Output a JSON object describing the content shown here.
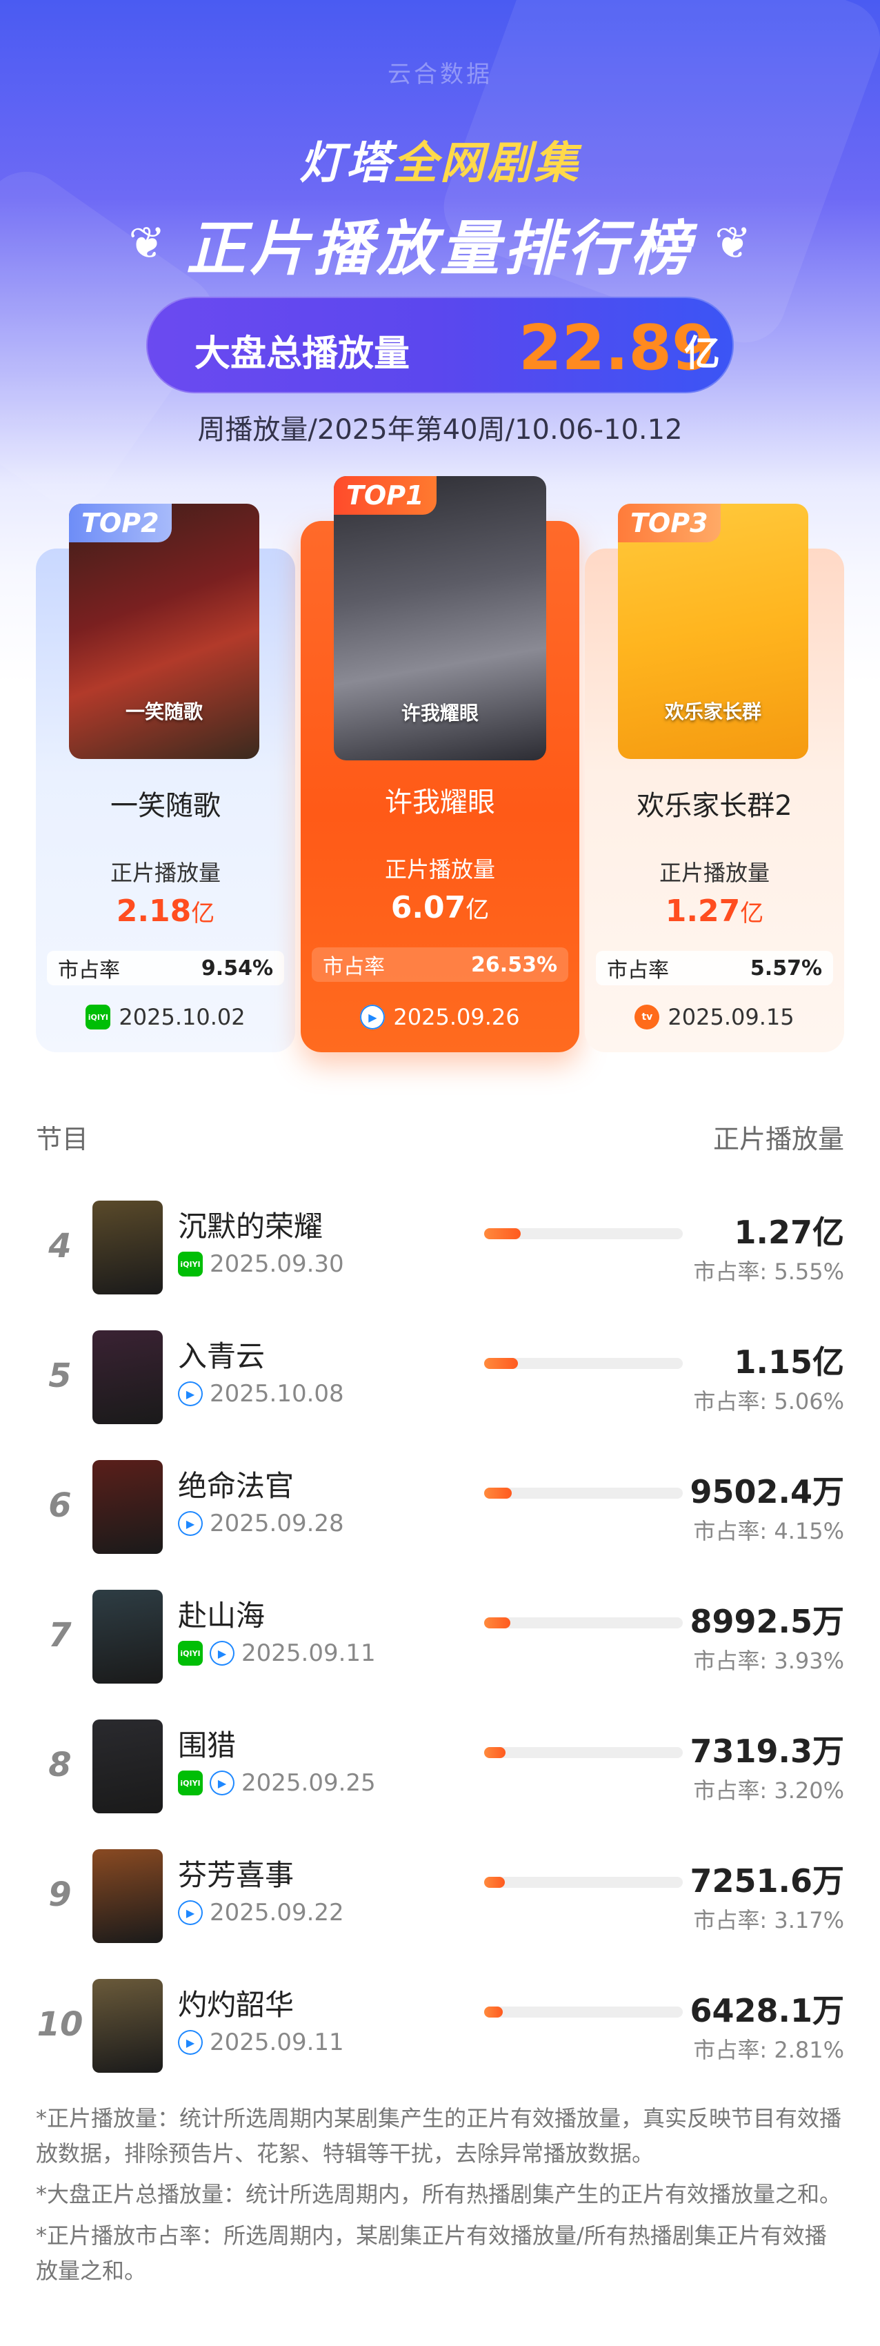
{
  "header": {
    "watermark": "云合数据",
    "title_prefix": "灯塔",
    "title_highlight": "全网剧集",
    "title_main": "正片播放量排行榜",
    "laurel_left": "❦",
    "laurel_right": "❦",
    "total_label": "大盘总播放量",
    "total_value": "22.89",
    "total_unit": "亿",
    "subtitle": "周播放量/2025年第40周/10.06-10.12"
  },
  "top3": [
    {
      "badge": "TOP2",
      "name": "一笑随歌",
      "poster_text": "一笑随歌",
      "metric_label": "正片播放量",
      "value": "2.18",
      "unit": "亿",
      "share_label": "市占率",
      "share": "9.54%",
      "platform": "iqiyi",
      "platform_icon": "iQIYI",
      "date": "2025.10.02"
    },
    {
      "badge": "TOP1",
      "name": "许我耀眼",
      "poster_text": "许我耀眼",
      "metric_label": "正片播放量",
      "value": "6.07",
      "unit": "亿",
      "share_label": "市占率",
      "share": "26.53%",
      "platform": "tencent",
      "platform_icon": "▶",
      "date": "2025.09.26"
    },
    {
      "badge": "TOP3",
      "name": "欢乐家长群2",
      "poster_text": "欢乐家长群",
      "metric_label": "正片播放量",
      "value": "1.27",
      "unit": "亿",
      "share_label": "市占率",
      "share": "5.57%",
      "platform": "mango",
      "platform_icon": "tv",
      "date": "2025.09.15"
    }
  ],
  "list_header": {
    "left": "节目",
    "right": "正片播放量"
  },
  "rows": [
    {
      "rank": "4",
      "title": "沉默的荣耀",
      "platforms": [
        "iqiyi"
      ],
      "date": "2025.09.30",
      "value": "1.27亿",
      "share": "市占率: 5.55%",
      "share_pct": 5.55,
      "color": "#5a4a2a"
    },
    {
      "rank": "5",
      "title": "入青云",
      "platforms": [
        "tencent"
      ],
      "date": "2025.10.08",
      "value": "1.15亿",
      "share": "市占率: 5.06%",
      "share_pct": 5.06,
      "color": "#3a2233"
    },
    {
      "rank": "6",
      "title": "绝命法官",
      "platforms": [
        "tencent"
      ],
      "date": "2025.09.28",
      "value": "9502.4万",
      "share": "市占率: 4.15%",
      "share_pct": 4.15,
      "color": "#5a1f1a"
    },
    {
      "rank": "7",
      "title": "赴山海",
      "platforms": [
        "iqiyi",
        "tencent"
      ],
      "date": "2025.09.11",
      "value": "8992.5万",
      "share": "市占率: 3.93%",
      "share_pct": 3.93,
      "color": "#2e3d44"
    },
    {
      "rank": "8",
      "title": "围猎",
      "platforms": [
        "iqiyi",
        "tencent"
      ],
      "date": "2025.09.25",
      "value": "7319.3万",
      "share": "市占率: 3.20%",
      "share_pct": 3.2,
      "color": "#2a2a2e"
    },
    {
      "rank": "9",
      "title": "芬芳喜事",
      "platforms": [
        "tencent"
      ],
      "date": "2025.09.22",
      "value": "7251.6万",
      "share": "市占率: 3.17%",
      "share_pct": 3.17,
      "color": "#8a4a22"
    },
    {
      "rank": "10",
      "title": "灼灼韶华",
      "platforms": [
        "tencent"
      ],
      "date": "2025.09.11",
      "value": "6428.1万",
      "share": "市占率: 2.81%",
      "share_pct": 2.81,
      "color": "#6a5a3a"
    }
  ],
  "notes": [
    "*正片播放量：统计所选周期内某剧集产生的正片有效播放量，真实反映节目有效播放数据，排除预告片、花絮、特辑等干扰，去除异常播放数据。",
    "*大盘正片总播放量：统计所选周期内，所有热播剧集产生的正片有效播放量之和。",
    "*正片播放市占率：所选周期内，某剧集正片有效播放量/所有热播剧集正片有效播放量之和。"
  ],
  "colors": {
    "accent": "#ff5a1f",
    "brand_blue": "#4a5bf2",
    "value_orange": "#ff8a1f"
  }
}
